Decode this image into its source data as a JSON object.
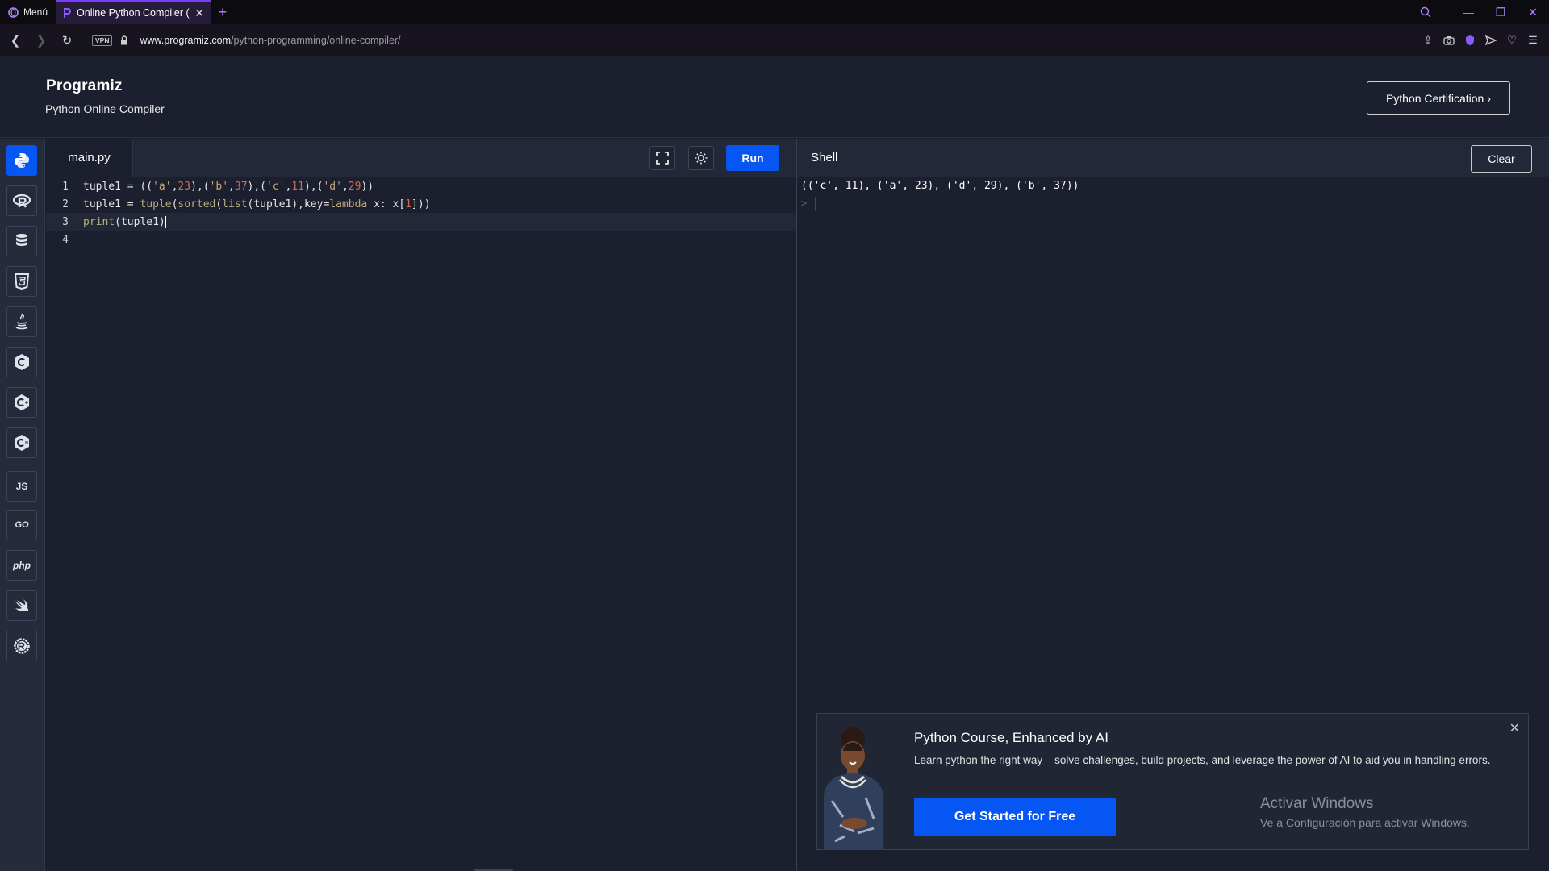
{
  "browser": {
    "menu_label": "Menú",
    "tab_title": "Online Python Compiler (In",
    "new_tab": "+",
    "url_host": "www.programiz.com",
    "url_path": "/python-programming/online-compiler/",
    "vpn_label": "VPN",
    "accent_color": "#7a3cff"
  },
  "header": {
    "logo": "Programiz",
    "subtitle": "Python Online Compiler",
    "cert_button": "Python Certification"
  },
  "sidebar": {
    "languages": [
      {
        "name": "python-icon",
        "label": ""
      },
      {
        "name": "r-icon",
        "label": ""
      },
      {
        "name": "sql-icon",
        "label": ""
      },
      {
        "name": "html-icon",
        "label": ""
      },
      {
        "name": "java-icon",
        "label": ""
      },
      {
        "name": "c-icon",
        "label": ""
      },
      {
        "name": "cpp-icon",
        "label": ""
      },
      {
        "name": "csharp-icon",
        "label": ""
      },
      {
        "name": "js-icon",
        "label": "JS"
      },
      {
        "name": "go-icon",
        "label": "GO"
      },
      {
        "name": "php-icon",
        "label": "php"
      },
      {
        "name": "swift-icon",
        "label": ""
      },
      {
        "name": "rust-icon",
        "label": ""
      }
    ]
  },
  "editor": {
    "file_name": "main.py",
    "run_label": "Run",
    "line_numbers": [
      "1",
      "2",
      "3",
      "4"
    ],
    "lines": [
      "tuple1 = (('a',23),('b',37),('c',11),('d',29))",
      "tuple1 = tuple(sorted(list(tuple1),key=lambda x: x[1]))",
      "print(tuple1)",
      ""
    ]
  },
  "shell": {
    "title": "Shell",
    "clear_label": "Clear",
    "output": "(('c', 11), ('a', 23), ('d', 29), ('b', 37))",
    "prompt": ">"
  },
  "ad": {
    "title": "Python Course, Enhanced by AI",
    "description": "Learn python the right way – solve challenges, build projects, and leverage the power of AI to aid you in handling errors.",
    "cta": "Get Started for Free",
    "close": "✕"
  },
  "watermark": {
    "title": "Activar Windows",
    "subtitle": "Ve a Configuración para activar Windows."
  },
  "colors": {
    "run_blue": "#0556f3",
    "bg": "#1b1f2e",
    "panel": "#232838"
  }
}
